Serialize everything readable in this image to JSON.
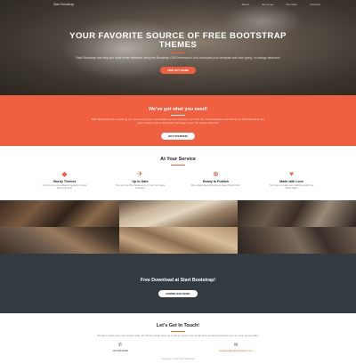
{
  "nav": {
    "brand": "Start Bootstrap",
    "links": [
      "About",
      "Services",
      "Portfolio",
      "Contact"
    ]
  },
  "hero": {
    "title": "YOUR FAVORITE SOURCE OF FREE BOOTSTRAP THEMES",
    "text": "Start Bootstrap can help you build better websites using the Bootstrap CSS framework! Just download your template and start going, no strings attached!",
    "button": "Find Out More"
  },
  "about": {
    "title": "We've got what you need!",
    "text": "Start Bootstrap has everything you need to get your new website up and running in no time! All of the templates and themes on Start Bootstrap are open source, free to download, and easy to use. No strings attached!",
    "button": "Get Started!"
  },
  "services": {
    "title": "At Your Service",
    "items": [
      {
        "icon": "diamond-icon",
        "glyph": "◆",
        "name": "Sturdy Themes",
        "desc": "Our themes are updated regularly to keep them bug free!"
      },
      {
        "icon": "paper-plane-icon",
        "glyph": "✈",
        "name": "Up to Date",
        "desc": "You can use this theme as is, or you can make changes!"
      },
      {
        "icon": "globe-icon",
        "glyph": "⊕",
        "name": "Ready to Publish",
        "desc": "We update dependencies to keep things fresh."
      },
      {
        "icon": "heart-icon",
        "glyph": "♥",
        "name": "Made with Love",
        "desc": "You have to make your websites with love these days!"
      }
    ]
  },
  "portfolio": {
    "tiles": [
      "portfolio-item-1",
      "portfolio-item-2",
      "portfolio-item-3",
      "portfolio-item-4",
      "portfolio-item-5",
      "portfolio-item-6"
    ]
  },
  "download": {
    "title": "Free Download at Start Bootstrap!",
    "button": "Download Now!"
  },
  "contact": {
    "title": "Let's Get In Touch!",
    "text": "Ready to start your next project with us? That's great! Give us a call or send us an email and we will get back to you as soon as possible!",
    "phone": "123-456-6789",
    "email": "feedback@startbootstrap.com"
  },
  "footer": {
    "text": "Copyright © 2017 Start Bootstrap"
  },
  "colors": {
    "accent": "#f05f40",
    "dark": "#333a40"
  }
}
